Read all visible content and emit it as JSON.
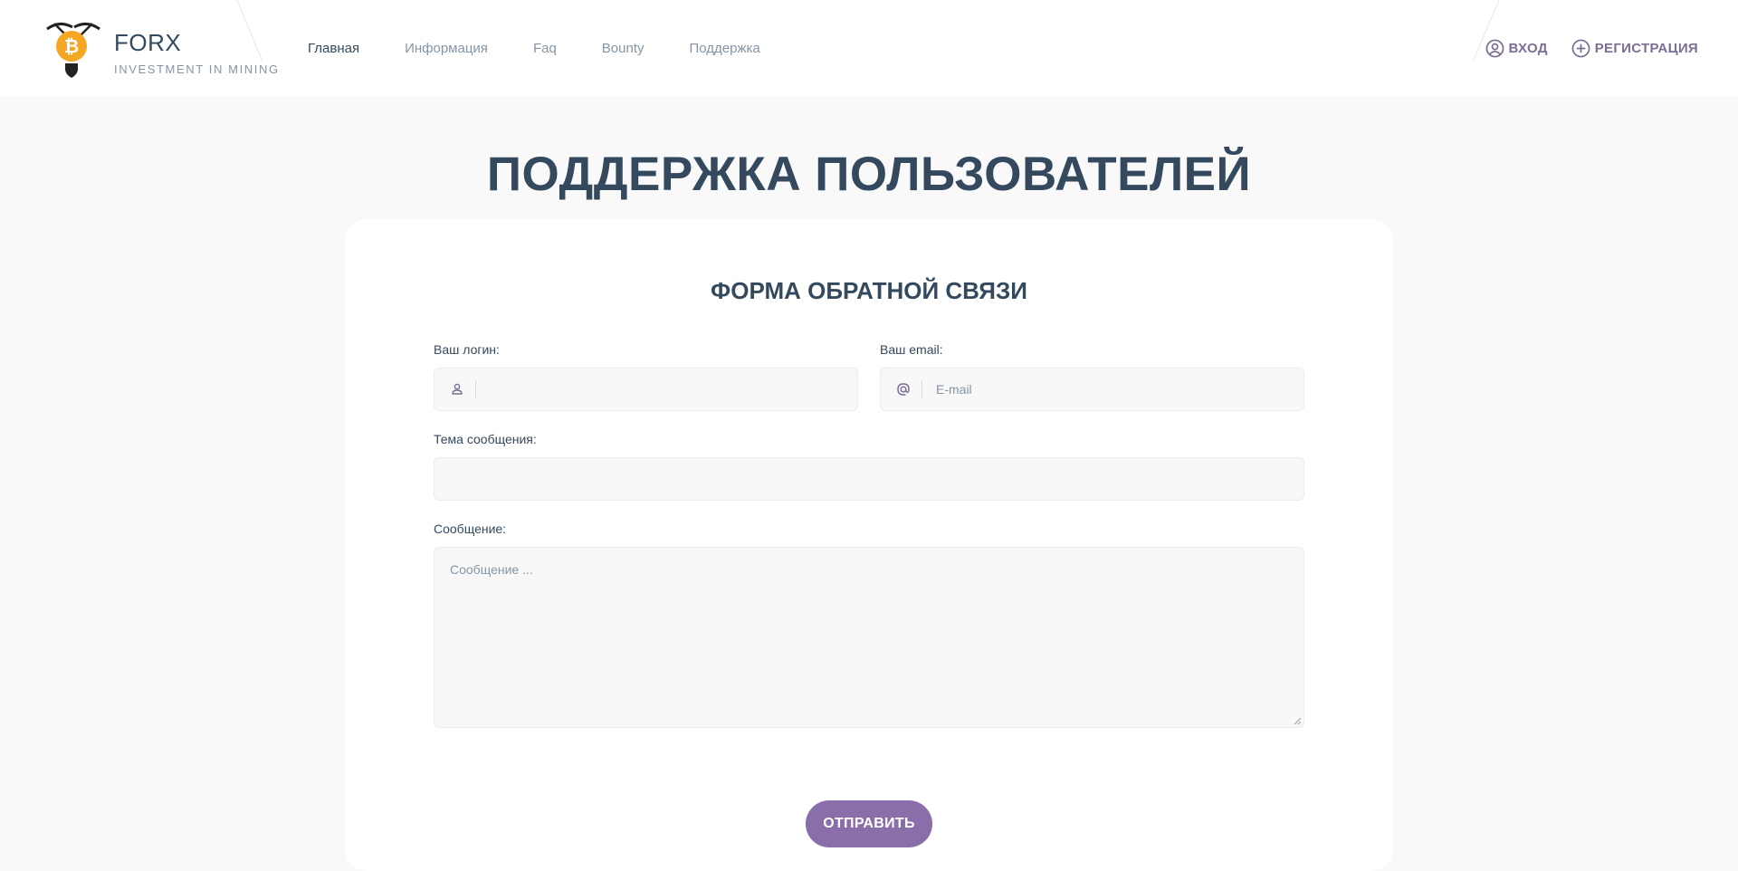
{
  "brand": {
    "name": "FORX",
    "tagline": "INVESTMENT IN MINING",
    "logo_icon": "bitcoin-miner-icon"
  },
  "nav": [
    {
      "label": "Главная",
      "active": true
    },
    {
      "label": "Информация",
      "active": false
    },
    {
      "label": "Faq",
      "active": false
    },
    {
      "label": "Bounty",
      "active": false
    },
    {
      "label": "Поддержка",
      "active": false
    }
  ],
  "auth": {
    "login_label": "ВХОД",
    "login_icon": "user-circle-icon",
    "register_label": "РЕГИСТРАЦИЯ",
    "register_icon": "plus-circle-icon"
  },
  "page": {
    "title": "ПОДДЕРЖКА ПОЛЬЗОВАТЕЛЕЙ"
  },
  "form": {
    "title": "ФОРМА ОБРАТНОЙ СВЯЗИ",
    "login": {
      "label": "Ваш логин:",
      "value": "",
      "placeholder": "",
      "icon": "user-icon"
    },
    "email": {
      "label": "Ваш email:",
      "value": "",
      "placeholder": "E-mail",
      "icon": "at-sign-icon"
    },
    "subject": {
      "label": "Тема сообщения:",
      "value": "",
      "placeholder": ""
    },
    "message": {
      "label": "Сообщение:",
      "value": "",
      "placeholder": "Сообщение ..."
    },
    "submit_label": "ОТПРАВИТЬ"
  },
  "colors": {
    "accent": "#8a6eaa",
    "text_dark": "#34495e",
    "text_muted": "#8395a7",
    "logo_orange": "#f5a623",
    "background": "#f9f9f9"
  }
}
